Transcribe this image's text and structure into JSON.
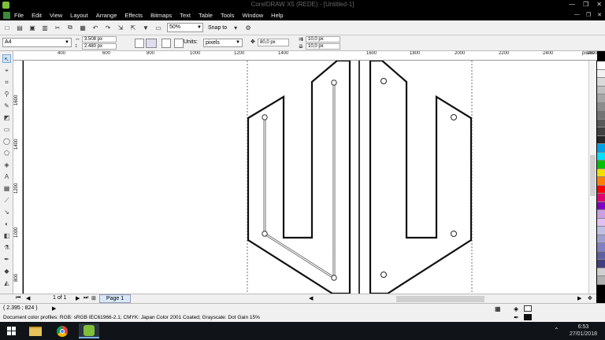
{
  "window": {
    "title": "CorelDRAW X5 (REDE) - [Untitled-1]",
    "min": "—",
    "max": "❐",
    "close": "✕"
  },
  "menu": [
    "File",
    "Edit",
    "View",
    "Layout",
    "Arrange",
    "Effects",
    "Bitmaps",
    "Text",
    "Table",
    "Tools",
    "Window",
    "Help"
  ],
  "mdi": {
    "min": "—",
    "restore": "❐",
    "close": "✕"
  },
  "toolbar": {
    "zoom": "50%",
    "snap_label": "Snap to"
  },
  "propertybar": {
    "page_size": "A4",
    "width": "3.508 px",
    "height": "2.480 px",
    "units_label": "Units:",
    "units_value": "pixels",
    "nudge": "80,0 px",
    "dup_x": "10,0 px",
    "dup_y": "10,0 px"
  },
  "ruler": {
    "top_labels": [
      "400",
      "600",
      "800",
      "1000",
      "1200",
      "1400",
      "1600",
      "1800",
      "2000",
      "2200",
      "2400",
      "2600",
      "pixels"
    ],
    "left_labels": [
      "1600",
      "1400",
      "1200",
      "1000",
      "800"
    ]
  },
  "palette": [
    "#ffffff",
    "#f2f2f2",
    "#d9d9d9",
    "#bfbfbf",
    "#a6a6a6",
    "#8c8c8c",
    "#737373",
    "#595959",
    "#404040",
    "#262626",
    "#00a0e3",
    "#00e0ff",
    "#00c000",
    "#f0e000",
    "#ff8000",
    "#ff0000",
    "#e00070",
    "#8000c0",
    "#c8a0e0",
    "#e0c0f0",
    "#c0c0e0",
    "#a0a0d0",
    "#8080c0",
    "#6060a0",
    "#404080",
    "#d0d0d0",
    "#b0b0b0"
  ],
  "pages": {
    "indicator": "1 of 1",
    "tab": "Page 1"
  },
  "status": {
    "coords": "( 2.395 ; 824 )",
    "profile": "Document color profiles: RGB: sRGB IEC61966-2.1; CMYK: Japan Color 2001 Coated; Grayscale: Dot Gain 15%"
  },
  "taskbar": {
    "time": "6:53",
    "date": "27/01/2018"
  }
}
